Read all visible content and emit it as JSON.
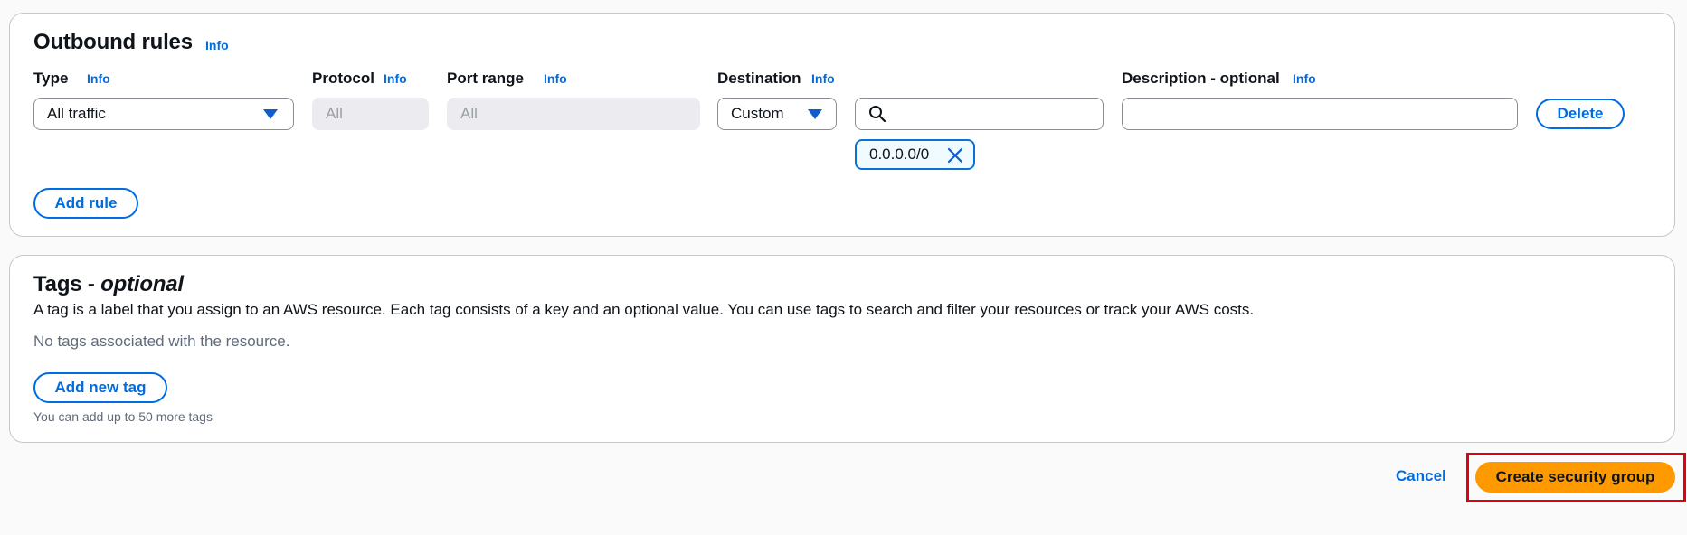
{
  "outbound": {
    "title": "Outbound rules",
    "info": "Info",
    "columns": {
      "type": "Type",
      "protocol": "Protocol",
      "port_range": "Port range",
      "destination": "Destination",
      "description": "Description - optional"
    },
    "rule": {
      "type_value": "All traffic",
      "protocol_value": "All",
      "port_range_value": "All",
      "destination_value": "Custom",
      "search_value": "",
      "description_value": "",
      "cidr_token": "0.0.0.0/0",
      "delete_label": "Delete"
    },
    "add_rule_label": "Add rule"
  },
  "tags": {
    "title_main": "Tags - ",
    "title_optional": "optional",
    "description": "A tag is a label that you assign to an AWS resource. Each tag consists of a key and an optional value. You can use tags to search and filter your resources or track your AWS costs.",
    "empty_text": "No tags associated with the resource.",
    "add_tag_label": "Add new tag",
    "limit_text": "You can add up to 50 more tags"
  },
  "footer": {
    "cancel_label": "Cancel",
    "create_label": "Create security group",
    "highlight_color": "#e1000f",
    "primary_color": "#ff9900"
  },
  "icons": {
    "search": "search-icon",
    "caret": "caret-down-icon",
    "remove": "close-icon"
  }
}
